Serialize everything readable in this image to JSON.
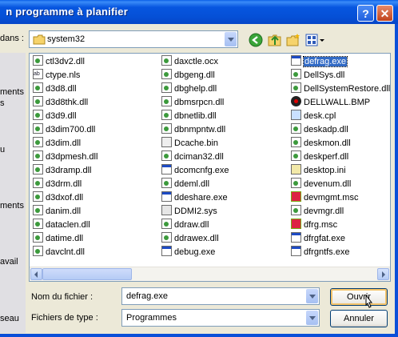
{
  "window": {
    "title": "n programme à planifier",
    "help_glyph": "?",
    "close_glyph": "✕"
  },
  "lookin": {
    "label": "dans :",
    "value": "system32"
  },
  "sidebar": {
    "items": [
      "ments",
      "s",
      "u",
      "ments",
      "avail",
      "seau"
    ]
  },
  "columns": [
    [
      "ctl3dv2.dll",
      "ctype.nls",
      "d3d8.dll",
      "d3d8thk.dll",
      "d3d9.dll",
      "d3dim700.dll",
      "d3dim.dll",
      "d3dpmesh.dll",
      "d3dramp.dll",
      "d3drm.dll",
      "d3dxof.dll",
      "danim.dll",
      "dataclen.dll",
      "datime.dll",
      "davclnt.dll"
    ],
    [
      "daxctle.ocx",
      "dbgeng.dll",
      "dbghelp.dll",
      "dbmsrpcn.dll",
      "dbnetlib.dll",
      "dbnmpntw.dll",
      "Dcache.bin",
      "dciman32.dll",
      "dcomcnfg.exe",
      "ddeml.dll",
      "ddeshare.exe",
      "DDMI2.sys",
      "ddraw.dll",
      "ddrawex.dll",
      "debug.exe"
    ],
    [
      "defrag.exe",
      "DellSys.dll",
      "DellSystemRestore.dll",
      "DELLWALL.BMP",
      "desk.cpl",
      "deskadp.dll",
      "deskmon.dll",
      "deskperf.dll",
      "desktop.ini",
      "devenum.dll",
      "devmgmt.msc",
      "devmgr.dll",
      "dfrg.msc",
      "dfrgfat.exe",
      "dfrgntfs.exe"
    ]
  ],
  "icons": [
    [
      "dll",
      "nls",
      "dll",
      "dll",
      "dll",
      "dll",
      "dll",
      "dll",
      "dll",
      "dll",
      "dll",
      "dll",
      "dll",
      "dll",
      "dll"
    ],
    [
      "ocx",
      "dll",
      "dll",
      "dll",
      "dll",
      "dll",
      "bin",
      "dll",
      "exe",
      "dll",
      "exe",
      "sys",
      "dll",
      "dll",
      "exe"
    ],
    [
      "exe",
      "dll",
      "dll",
      "bmp",
      "cpl",
      "dll",
      "dll",
      "dll",
      "ini",
      "dll",
      "msc",
      "dll",
      "msc",
      "exe",
      "exe"
    ]
  ],
  "selected": "defrag.exe",
  "filename": {
    "label": "Nom du fichier :",
    "value": "defrag.exe"
  },
  "filetype": {
    "label": "Fichiers de type :",
    "value": "Programmes"
  },
  "buttons": {
    "open": "Ouvrir",
    "cancel": "Annuler"
  },
  "colors": {
    "title_bar": "#0550d6",
    "selection": "#316ac5",
    "dialog_bg": "#ece9d8"
  }
}
